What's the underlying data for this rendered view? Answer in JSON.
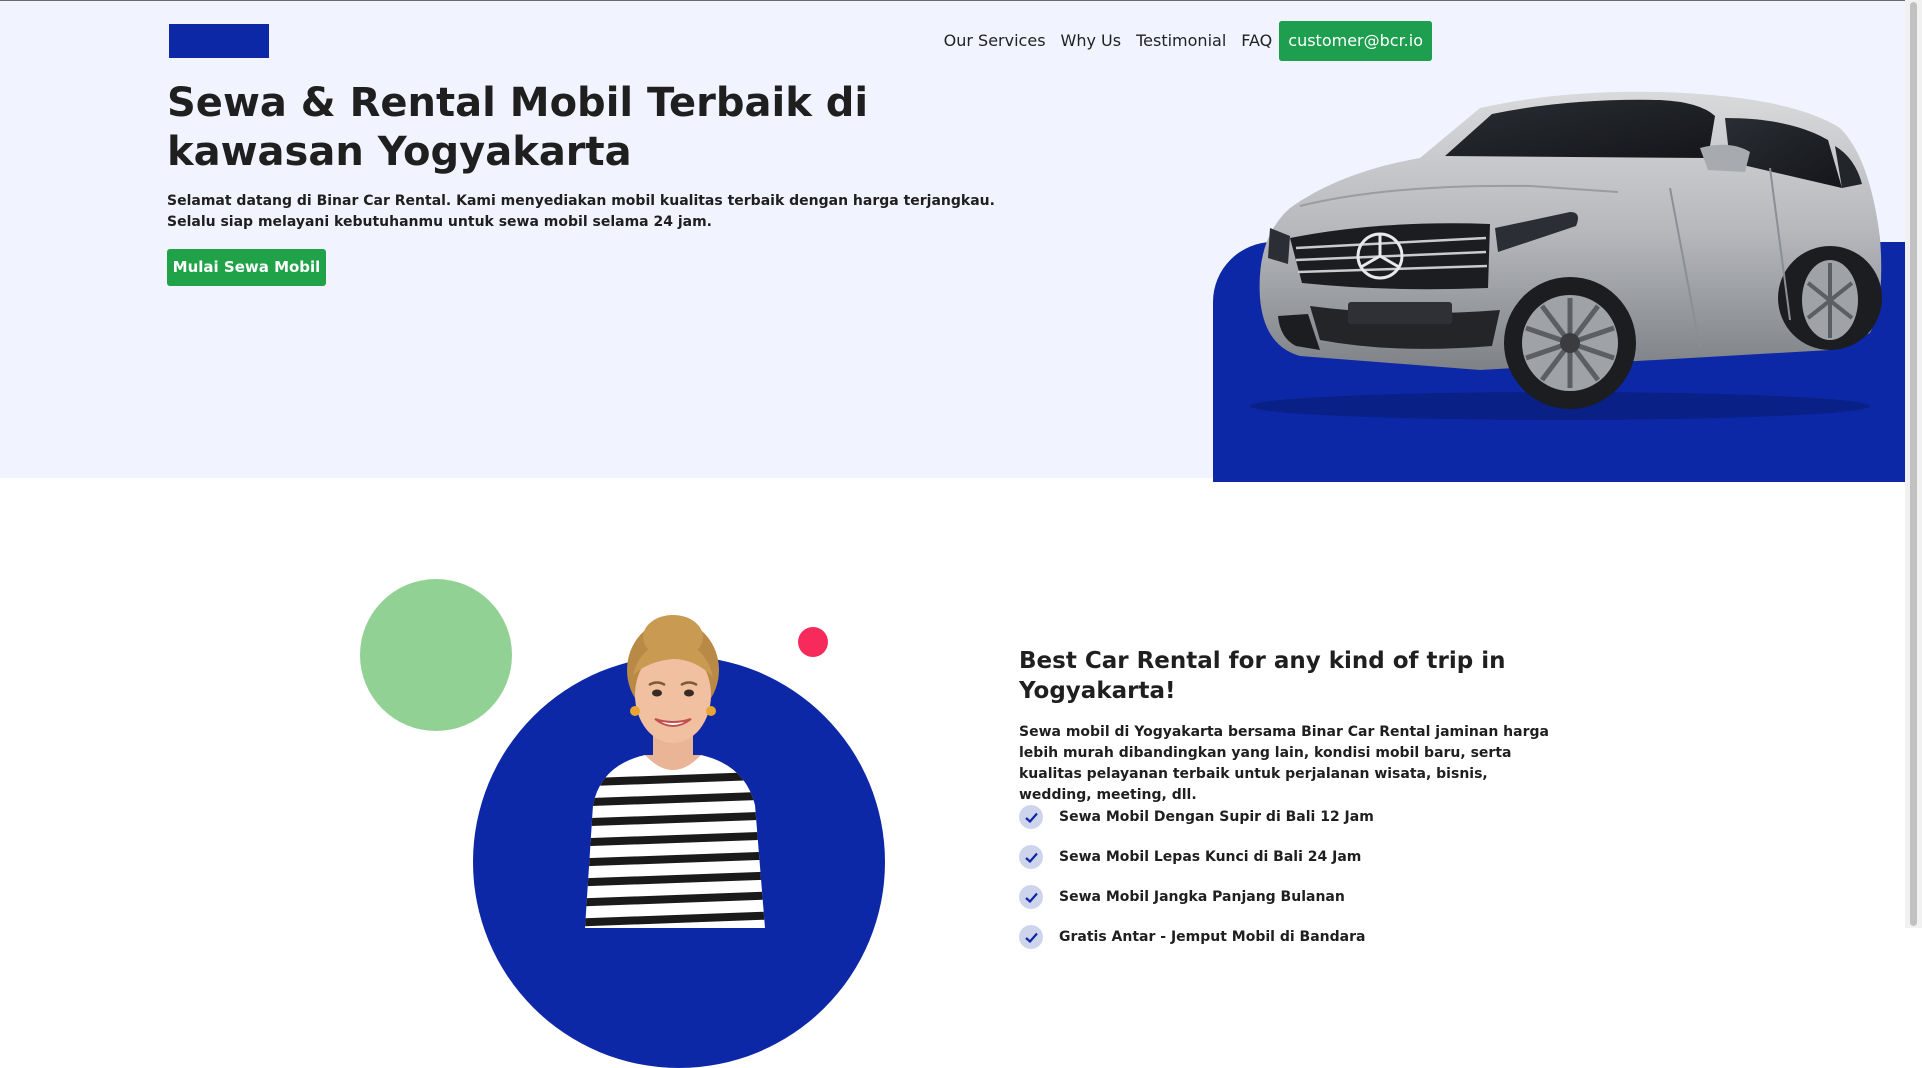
{
  "header": {
    "logo_alt": "",
    "nav": [
      "Our Services",
      "Why Us",
      "Testimonial",
      "FAQ"
    ],
    "cta": "customer@bcr.io"
  },
  "hero": {
    "title": "Sewa & Rental Mobil Terbaik di kawasan Yogyakarta",
    "desc_line1": "Selamat datang di Binar Car Rental. Kami menyediakan mobil kualitas terbaik dengan harga terjangkau.",
    "desc_line2": "Selalu siap melayani kebutuhanmu untuk sewa mobil selama 24 jam.",
    "button": "Mulai Sewa Mobil"
  },
  "about": {
    "title": "Best Car Rental for any kind of trip in Yogyakarta!",
    "desc": "Sewa mobil di Yogyakarta bersama Binar Car Rental jaminan harga lebih murah dibandingkan yang lain, kondisi mobil baru, serta kualitas pelayanan terbaik untuk perjalanan wisata, bisnis, wedding, meeting, dll.",
    "checklist": [
      "Sewa Mobil Dengan Supir di Bali 12 Jam",
      "Sewa Mobil Lepas Kunci di Bali 24 Jam",
      "Sewa Mobil Jangka Panjang Bulanan",
      "Gratis Antar - Jemput Mobil di Bandara"
    ]
  },
  "colors": {
    "primary": "#0d28a6",
    "hero_bg": "#f1f3ff",
    "cta_green": "#1e9e4f",
    "accent_green": "#92d194",
    "accent_red": "#f62b5b"
  },
  "icons": [
    "car-image",
    "woman-image",
    "check-icon"
  ]
}
